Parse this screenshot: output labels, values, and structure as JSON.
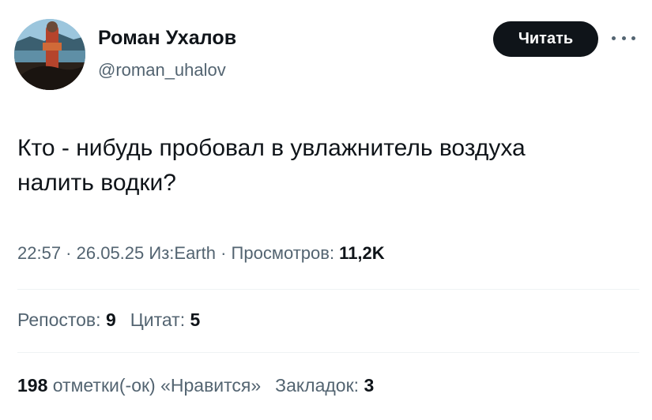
{
  "author": {
    "name": "Роман Ухалов",
    "handle": "@roman_uhalov"
  },
  "follow_button": {
    "label": "Читать"
  },
  "more_icon": "more-horizontal-icon",
  "tweet": {
    "text_line1": "Кто - нибудь пробовал в увлажнитель воздуха",
    "text_line2": "налить водки?"
  },
  "meta": {
    "time": "22:57",
    "sep1": " · ",
    "date": "26.05.25",
    "source_prefix": " Из:",
    "source": "Earth",
    "sep2": " · ",
    "views_label": "Просмотров: ",
    "views_value": "11,2K"
  },
  "stats1": {
    "reposts_label": "Репостов: ",
    "reposts_value": "9",
    "quotes_label": "Цитат: ",
    "quotes_value": "5"
  },
  "stats2": {
    "likes_value": "198",
    "likes_label": " отметки(-ок) «Нравится»",
    "bookmarks_label": "Закладок: ",
    "bookmarks_value": "3"
  },
  "colors": {
    "text": "#0f1419",
    "secondary": "#536471",
    "divider": "#eff3f4",
    "button_bg": "#0f1419",
    "button_text": "#ffffff"
  }
}
